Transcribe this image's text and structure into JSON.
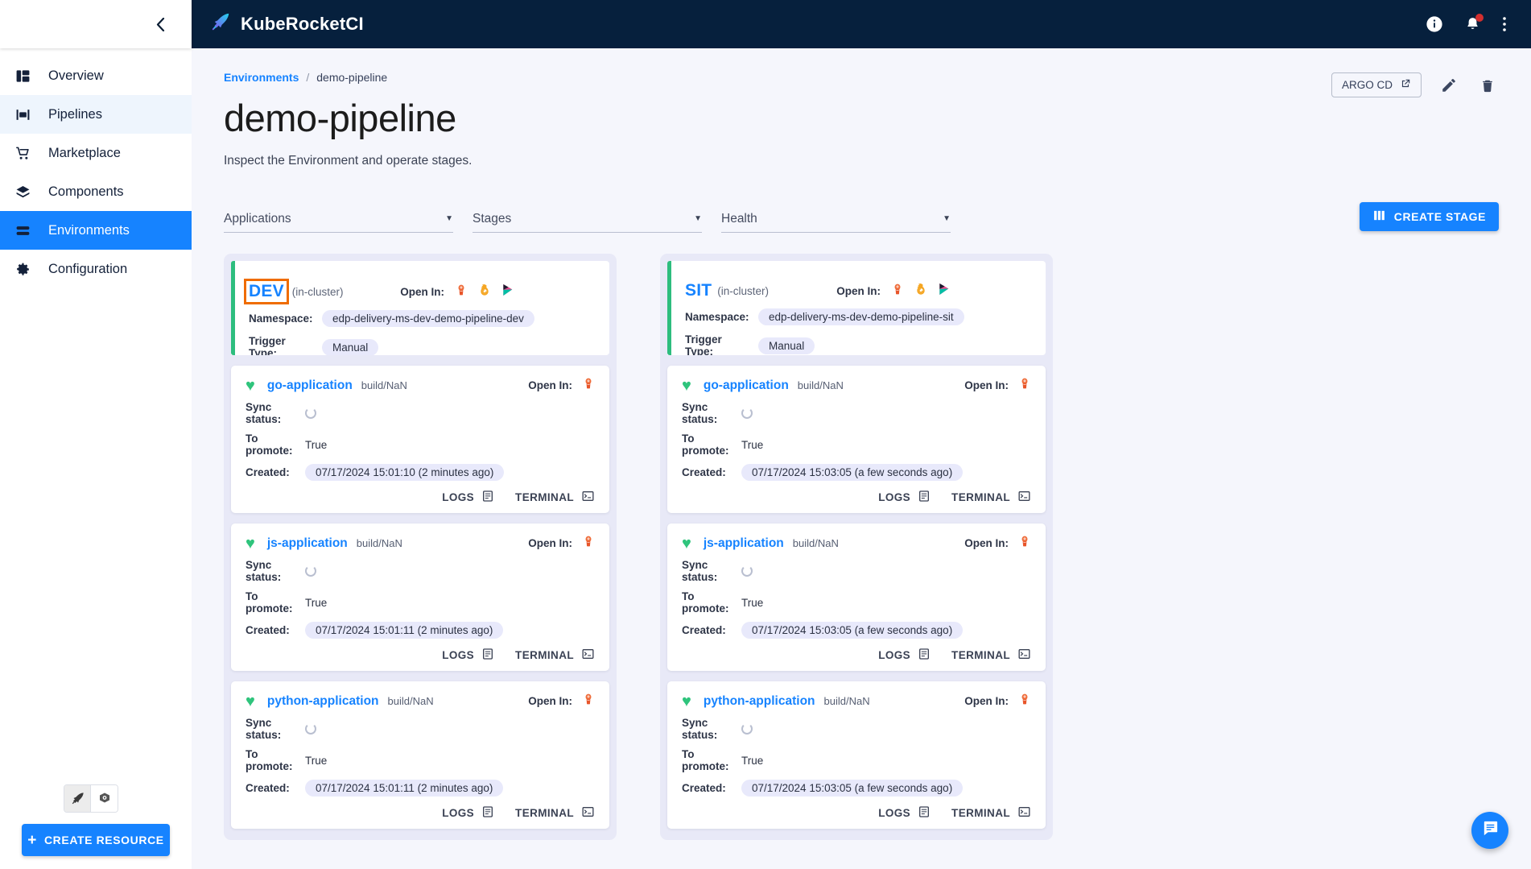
{
  "sidebar": {
    "collapse_icon": "chevron-left-icon",
    "items": [
      {
        "label": "Overview",
        "icon": "dashboard-icon",
        "state": "normal"
      },
      {
        "label": "Pipelines",
        "icon": "pipelines-icon",
        "state": "hovered"
      },
      {
        "label": "Marketplace",
        "icon": "cart-icon",
        "state": "normal"
      },
      {
        "label": "Components",
        "icon": "layers-icon",
        "state": "normal"
      },
      {
        "label": "Environments",
        "icon": "environments-icon",
        "state": "active"
      },
      {
        "label": "Configuration",
        "icon": "gear-icon",
        "state": "normal"
      }
    ],
    "view_toggle": [
      {
        "icon": "krci-rocket-icon",
        "selected": true
      },
      {
        "icon": "kubernetes-icon",
        "selected": false
      }
    ],
    "create_resource_label": "CREATE RESOURCE",
    "create_resource_icon": "plus-icon"
  },
  "topbar": {
    "brand": "KubeRocketCI",
    "brand_icon": "krci-rocket-icon",
    "actions": [
      {
        "icon": "info-icon",
        "name": "info-button"
      },
      {
        "icon": "bell-icon",
        "name": "notifications-button",
        "badge": true
      },
      {
        "icon": "more-vertical-icon",
        "name": "more-menu-button"
      }
    ]
  },
  "breadcrumb": {
    "root": "Environments",
    "separator": "/",
    "current": "demo-pipeline"
  },
  "page": {
    "title": "demo-pipeline",
    "subtitle": "Inspect the Environment and operate stages.",
    "argocd_label": "ARGO CD",
    "argocd_icon": "external-link-icon",
    "edit_icon": "pencil-icon",
    "delete_icon": "trash-icon"
  },
  "filters": [
    {
      "label": "Applications",
      "name": "filter-applications"
    },
    {
      "label": "Stages",
      "name": "filter-stages"
    },
    {
      "label": "Health",
      "name": "filter-health"
    }
  ],
  "create_stage": {
    "label": "CREATE STAGE",
    "icon": "columns-icon"
  },
  "labels": {
    "open_in": "Open In:",
    "namespace": "Namespace:",
    "trigger_type": "Trigger Type:",
    "sync_status": "Sync status:",
    "to_promote": "To promote:",
    "created": "Created:",
    "logs": "LOGS",
    "terminal": "TERMINAL"
  },
  "colors": {
    "accent": "#1683ff",
    "topbar_bg": "#06203d",
    "stage_accent": "#2dbd7e",
    "health_green": "#2fc47c",
    "focus_orange": "#ef6c00",
    "column_bg": "#e8e9f7"
  },
  "stages": [
    {
      "name": "DEV",
      "cluster": "(in-cluster)",
      "focused": true,
      "namespace": "edp-delivery-ms-dev-demo-pipeline-dev",
      "trigger_type": "Manual",
      "open_in": [
        "argocd-icon",
        "grafana-icon",
        "kibana-icon"
      ],
      "applications": [
        {
          "name": "go-application",
          "build": "build/NaN",
          "health": "healthy",
          "sync_status": "syncing",
          "to_promote": "True",
          "created": "07/17/2024 15:01:10 (2 minutes ago)",
          "open_in": [
            "argocd-icon"
          ]
        },
        {
          "name": "js-application",
          "build": "build/NaN",
          "health": "healthy",
          "sync_status": "syncing",
          "to_promote": "True",
          "created": "07/17/2024 15:01:11 (2 minutes ago)",
          "open_in": [
            "argocd-icon"
          ]
        },
        {
          "name": "python-application",
          "build": "build/NaN",
          "health": "healthy",
          "sync_status": "syncing",
          "to_promote": "True",
          "created": "07/17/2024 15:01:11 (2 minutes ago)",
          "open_in": [
            "argocd-icon"
          ]
        }
      ]
    },
    {
      "name": "SIT",
      "cluster": "(in-cluster)",
      "focused": false,
      "namespace": "edp-delivery-ms-dev-demo-pipeline-sit",
      "trigger_type": "Manual",
      "open_in": [
        "argocd-icon",
        "grafana-icon",
        "kibana-icon"
      ],
      "applications": [
        {
          "name": "go-application",
          "build": "build/NaN",
          "health": "healthy",
          "sync_status": "syncing",
          "to_promote": "True",
          "created": "07/17/2024 15:03:05 (a few seconds ago)",
          "open_in": [
            "argocd-icon"
          ]
        },
        {
          "name": "js-application",
          "build": "build/NaN",
          "health": "healthy",
          "sync_status": "syncing",
          "to_promote": "True",
          "created": "07/17/2024 15:03:05 (a few seconds ago)",
          "open_in": [
            "argocd-icon"
          ]
        },
        {
          "name": "python-application",
          "build": "build/NaN",
          "health": "healthy",
          "sync_status": "syncing",
          "to_promote": "True",
          "created": "07/17/2024 15:03:05 (a few seconds ago)",
          "open_in": [
            "argocd-icon"
          ]
        }
      ]
    }
  ],
  "fab": {
    "icon": "chat-icon",
    "name": "support-chat-button"
  }
}
